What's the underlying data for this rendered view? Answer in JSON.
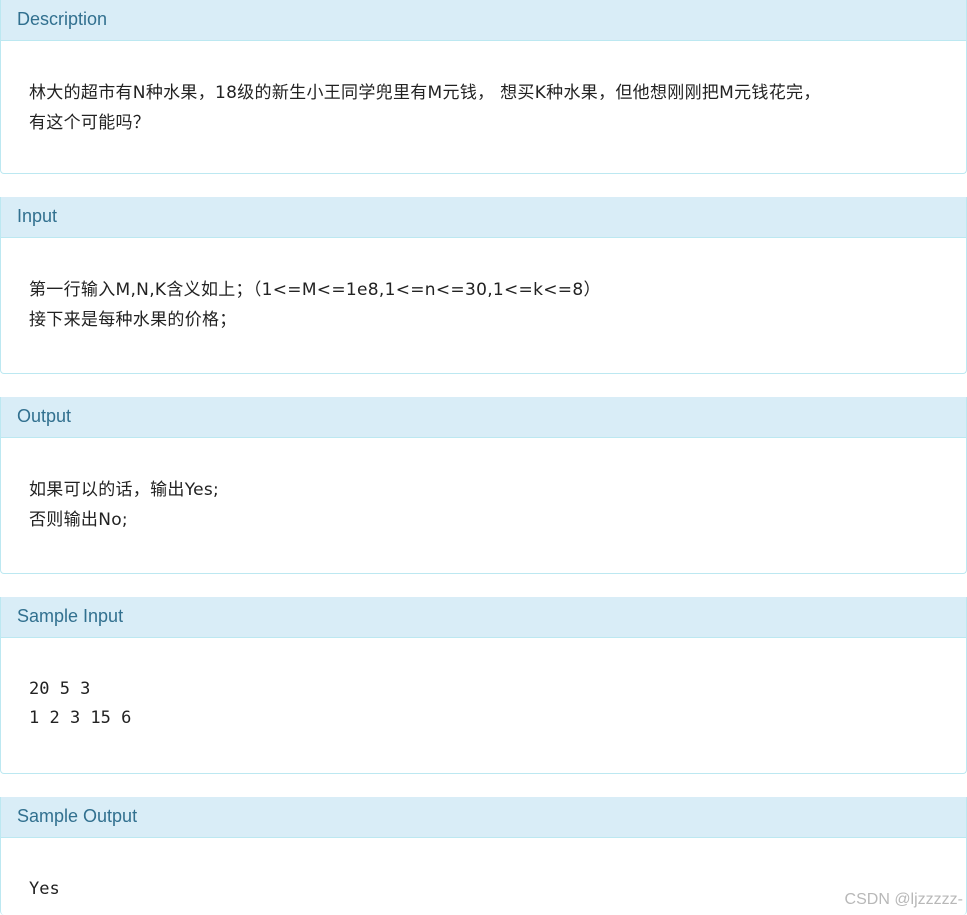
{
  "sections": {
    "description": {
      "title": "Description",
      "lines": [
        "林大的超市有N种水果，18级的新生小王同学兜里有M元钱， 想买K种水果，但他想刚刚把M元钱花完，",
        "有这个可能吗？"
      ]
    },
    "input": {
      "title": "Input",
      "lines": [
        "第一行输入M,N,K含义如上；（1<=M<=1e8,1<=n<=30,1<=k<=8）",
        "接下来是每种水果的价格；"
      ]
    },
    "output": {
      "title": "Output",
      "lines": [
        "如果可以的话，输出Yes;",
        "否则输出No;"
      ]
    },
    "sample_input": {
      "title": "Sample Input",
      "lines": [
        "20 5 3",
        "1 2 3 15 6"
      ]
    },
    "sample_output": {
      "title": "Sample Output",
      "lines": [
        "Yes"
      ]
    }
  },
  "watermark": "CSDN @ljzzzzz-",
  "colors": {
    "heading_bg": "#d9edf7",
    "heading_text": "#31708f",
    "border": "#bce8f1"
  }
}
